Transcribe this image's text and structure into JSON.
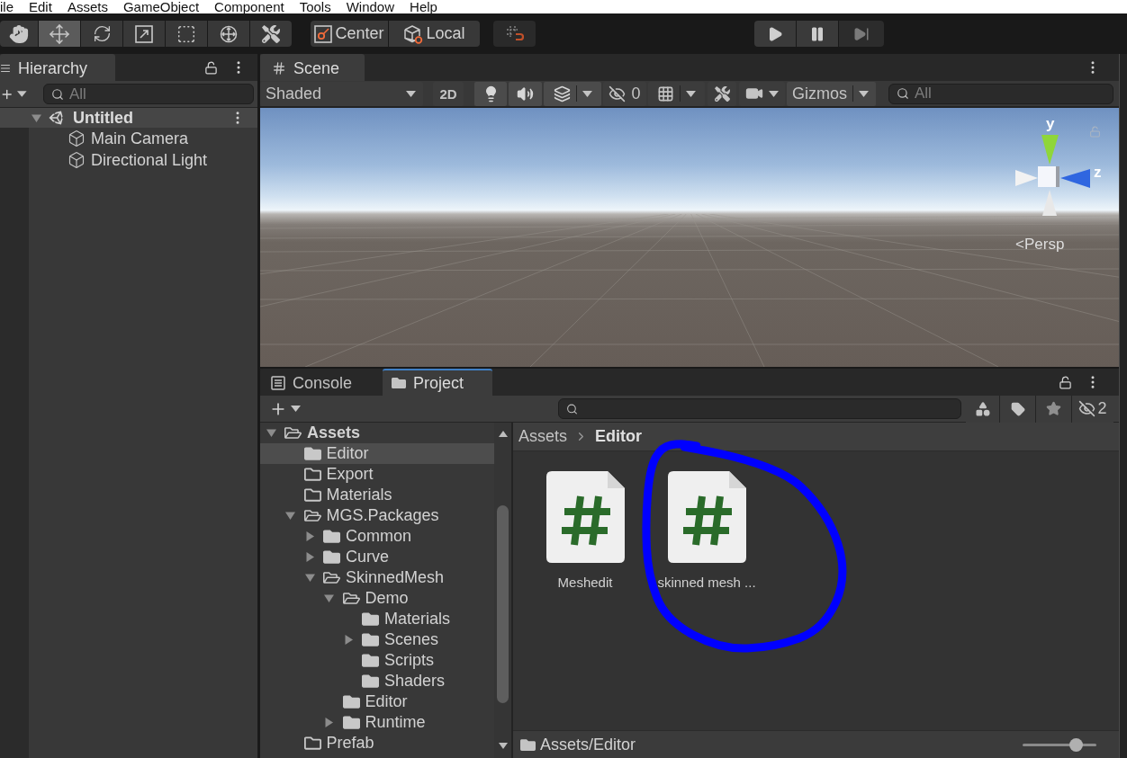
{
  "menu_bar": {
    "items": [
      "ile",
      "Edit",
      "Assets",
      "GameObject",
      "Component",
      "Tools",
      "Window",
      "Help"
    ]
  },
  "toolbar": {
    "tools": [
      {
        "kind": "hand",
        "selected": false
      },
      {
        "kind": "move",
        "selected": true
      },
      {
        "kind": "rotate",
        "selected": false
      },
      {
        "kind": "scale",
        "selected": false
      },
      {
        "kind": "rect",
        "selected": false
      },
      {
        "kind": "transform",
        "selected": false
      },
      {
        "kind": "custom",
        "selected": false
      }
    ],
    "handle_buttons": [
      {
        "kind": "pivot",
        "label": "Center"
      },
      {
        "kind": "space",
        "label": "Local"
      }
    ],
    "play_controls": [
      {
        "kind": "play",
        "disabled": false
      },
      {
        "kind": "pause",
        "disabled": false
      },
      {
        "kind": "step",
        "disabled": true
      }
    ]
  },
  "hierarchy": {
    "tab": {
      "label": "Hierarchy",
      "selected": true
    },
    "search": {
      "placeholder": "All"
    },
    "tree": [
      {
        "kind": "scene",
        "label": "Untitled",
        "expanded": true,
        "children": [
          {
            "kind": "object",
            "label": "Main Camera"
          },
          {
            "kind": "object",
            "label": "Directional Light"
          }
        ]
      }
    ]
  },
  "scene": {
    "tab": {
      "label": "Scene",
      "selected": true
    },
    "toolbar": [
      {
        "kind": "dropdown",
        "label": "Shaded"
      },
      {
        "kind": "toggle",
        "label": "2D",
        "on": false
      },
      {
        "kind": "lighting",
        "on": true
      },
      {
        "kind": "audio",
        "on": true
      },
      {
        "kind": "effects",
        "on": true
      },
      {
        "kind": "hidden",
        "label": "0"
      },
      {
        "kind": "grid"
      },
      {
        "kind": "tools"
      },
      {
        "kind": "camera"
      },
      {
        "kind": "gizmos",
        "label": "Gizmos"
      },
      {
        "kind": "search",
        "placeholder": "All"
      }
    ],
    "gizmo": {
      "axes": [
        "y",
        "z"
      ],
      "projection": "<Persp"
    }
  },
  "bottom_panel": {
    "tabs": [
      {
        "kind": "console",
        "label": "Console",
        "selected": false
      },
      {
        "kind": "project",
        "label": "Project",
        "selected": true
      }
    ],
    "toolbar": {
      "hidden_count": "2"
    },
    "tree": [
      {
        "kind": "branch",
        "label": "Assets",
        "expanded": true,
        "selected": false,
        "children": [
          {
            "kind": "folder",
            "label": "Editor",
            "expanded": false,
            "selected": true
          },
          {
            "kind": "empty",
            "label": "Export",
            "expanded": false,
            "selected": false
          },
          {
            "kind": "empty",
            "label": "Materials",
            "expanded": false,
            "selected": false
          },
          {
            "kind": "branch",
            "label": "MGS.Packages",
            "expanded": true,
            "selected": false,
            "children": [
              {
                "kind": "branch",
                "label": "Common",
                "expanded": false,
                "selected": false
              },
              {
                "kind": "branch",
                "label": "Curve",
                "expanded": false,
                "selected": false
              },
              {
                "kind": "branch",
                "label": "SkinnedMesh",
                "expanded": true,
                "selected": false,
                "children": [
                  {
                    "kind": "branch",
                    "label": "Demo",
                    "expanded": true,
                    "selected": false,
                    "children": [
                      {
                        "kind": "folder",
                        "label": "Materials",
                        "expanded": false,
                        "selected": false
                      },
                      {
                        "kind": "branch",
                        "label": "Scenes",
                        "expanded": false,
                        "selected": false
                      },
                      {
                        "kind": "folder",
                        "label": "Scripts",
                        "expanded": false,
                        "selected": false
                      },
                      {
                        "kind": "folder",
                        "label": "Shaders",
                        "expanded": false,
                        "selected": false
                      }
                    ]
                  },
                  {
                    "kind": "folder",
                    "label": "Editor",
                    "expanded": false,
                    "selected": false
                  },
                  {
                    "kind": "branch",
                    "label": "Runtime",
                    "expanded": false,
                    "selected": false
                  }
                ]
              }
            ]
          },
          {
            "kind": "empty",
            "label": "Prefab",
            "expanded": false,
            "selected": false
          }
        ]
      }
    ],
    "breadcrumb": [
      "Assets",
      "Editor"
    ],
    "assets": [
      {
        "kind": "script",
        "label": "Meshedit"
      },
      {
        "kind": "script",
        "label": "skinned mesh ..."
      }
    ],
    "status_path": "Assets/Editor",
    "zoom_slider": {
      "level": 0.72
    }
  }
}
